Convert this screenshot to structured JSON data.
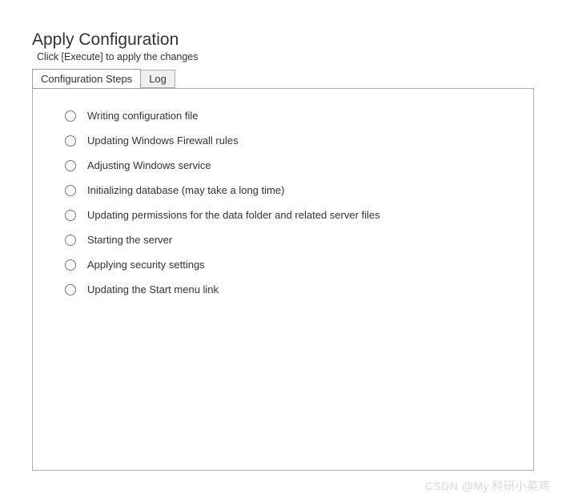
{
  "header": {
    "title": "Apply Configuration",
    "subtitle": "Click [Execute] to apply the changes"
  },
  "tabs": [
    {
      "label": "Configuration Steps",
      "active": true
    },
    {
      "label": "Log",
      "active": false
    }
  ],
  "steps": [
    {
      "label": "Writing configuration file"
    },
    {
      "label": "Updating Windows Firewall rules"
    },
    {
      "label": "Adjusting Windows service"
    },
    {
      "label": "Initializing database (may take a long time)"
    },
    {
      "label": "Updating permissions for the data folder and related server files"
    },
    {
      "label": "Starting the server"
    },
    {
      "label": "Applying security settings"
    },
    {
      "label": "Updating the Start menu link"
    }
  ],
  "watermark": "CSDN @My.科研小菜鸡"
}
